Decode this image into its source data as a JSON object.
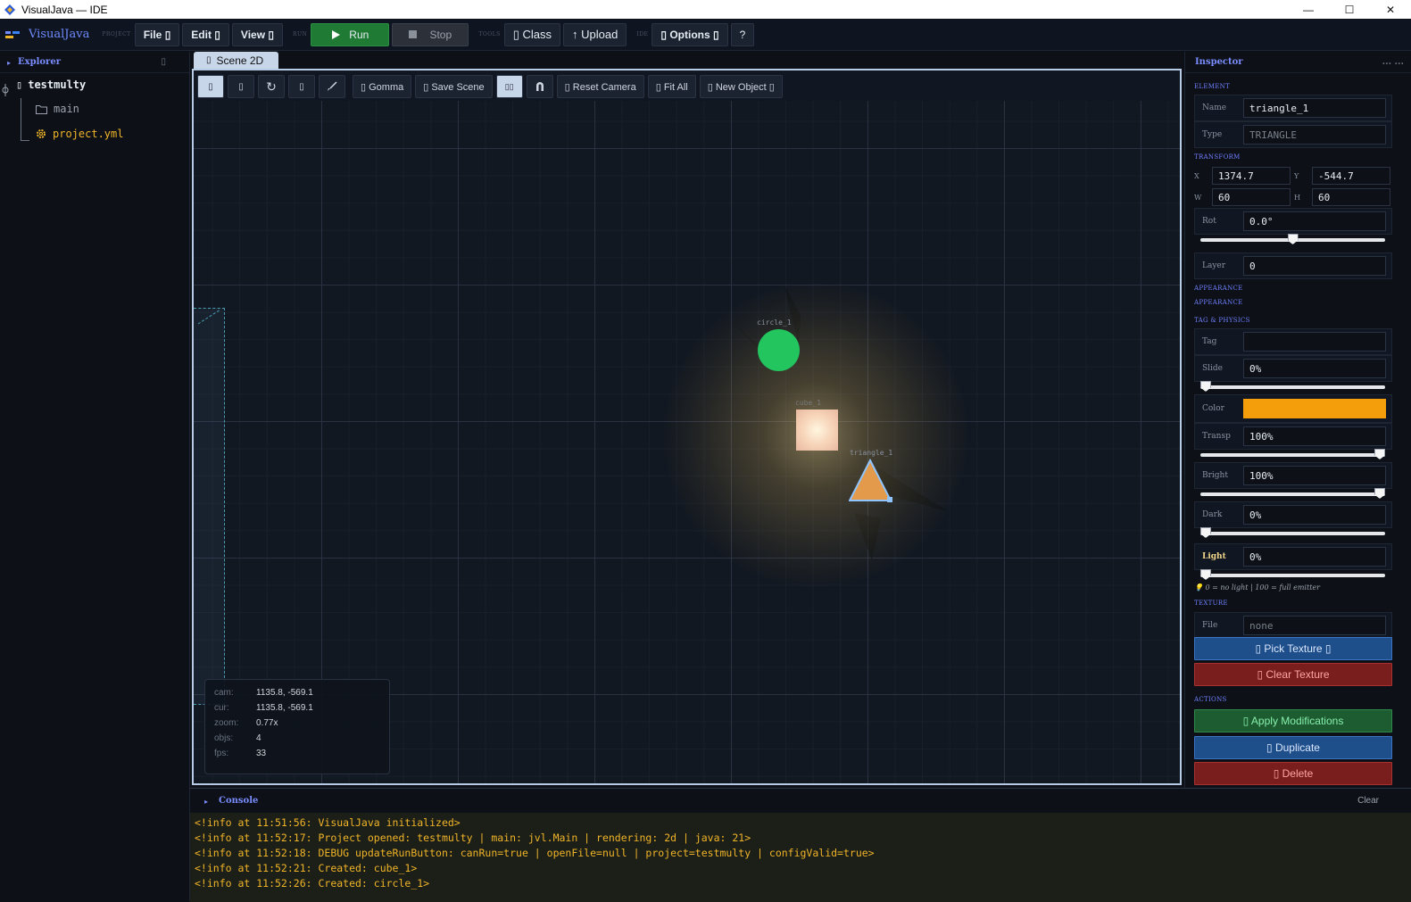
{
  "window": {
    "title": "VisualJava — IDE",
    "minimize": "—",
    "maximize": "☐",
    "close": "✕"
  },
  "toolbar": {
    "brand": "VisualJava",
    "groups": {
      "project": "PROJECT",
      "run": "RUN",
      "tools": "TOOLS",
      "ide": "IDE"
    },
    "file": "File ▯",
    "edit": "Edit ▯",
    "view": "View ▯",
    "run": "Run",
    "stop": "Stop",
    "class": "▯ Class",
    "upload": "↑ Upload",
    "options": "▯ Options ▯",
    "help": "?"
  },
  "explorer": {
    "title": "Explorer",
    "collapse": "▯",
    "root": "testmulty",
    "items": [
      {
        "label": "main",
        "color": "#9ca3af"
      },
      {
        "label": "project.yml",
        "color": "#f0b429"
      }
    ]
  },
  "scene": {
    "tab": "Scene 2D",
    "toolbar": {
      "gomma": "▯ Gomma",
      "save": "▯ Save Scene",
      "reset_camera": "▯ Reset Camera",
      "fit_all": "▯ Fit All",
      "new_object": "▯ New Object ▯"
    },
    "objects": {
      "circle": "circle_1",
      "cube": "cube_1",
      "triangle": "triangle_1"
    },
    "hud": {
      "cam_label": "cam:",
      "cam": "1135.8, -569.1",
      "cur_label": "cur:",
      "cur": "1135.8, -569.1",
      "zoom_label": "zoom:",
      "zoom": "0.77x",
      "objs_label": "objs:",
      "objs": "4",
      "fps_label": "fps:",
      "fps": "33"
    }
  },
  "inspector": {
    "title": "Inspector",
    "menu": "...   ...",
    "sections": {
      "element": "ELEMENT",
      "transform": "TRANSFORM",
      "appearance": "APPEARANCE",
      "appearance2": "APPEARANCE",
      "tag_physics": "TAG & PHYSICS",
      "texture": "TEXTURE",
      "actions": "ACTIONS"
    },
    "name_label": "Name",
    "name": "triangle_1",
    "type_label": "Type",
    "type": "TRIANGLE",
    "x_label": "X",
    "x": "1374.7",
    "y_label": "Y",
    "y": "-544.7",
    "w_label": "W",
    "w": "60",
    "h_label": "H",
    "h": "60",
    "rot_label": "Rot",
    "rot": "0.0°",
    "rot_slider": 0.5,
    "layer_label": "Layer",
    "layer": "0",
    "tag_label": "Tag",
    "tag": "",
    "slide_label": "Slide",
    "slide": "0%",
    "slide_level": 0,
    "color_label": "Color",
    "color": "#f59e0b",
    "transp_label": "Transp",
    "transp": "100%",
    "transp_level": 1,
    "bright_label": "Bright",
    "bright": "100%",
    "bright_level": 1,
    "dark_label": "Dark",
    "dark": "0%",
    "dark_level": 0,
    "light_label": "Light",
    "light": "0%",
    "light_level": 0,
    "light_hint": "💡 0 = no light  |  100 = full emitter",
    "file_label": "File",
    "file": "none",
    "pick_texture": "▯ Pick Texture ▯",
    "clear_texture": "▯ Clear Texture",
    "apply": "▯ Apply Modifications",
    "duplicate": "▯ Duplicate",
    "delete": "▯ Delete"
  },
  "console": {
    "title": "Console",
    "clear": "Clear",
    "lines": [
      "<!info at 11:51:56: VisualJava initialized>",
      "<!info at 11:52:17: Project opened: testmulty | main: jvl.Main | rendering: 2d | java: 21>",
      "<!info at 11:52:18: DEBUG updateRunButton: canRun=true | openFile=null | project=testmulty | configValid=true>",
      "<!info at 11:52:21: Created: cube_1>",
      "<!info at 11:52:26: Created: circle_1>"
    ]
  }
}
